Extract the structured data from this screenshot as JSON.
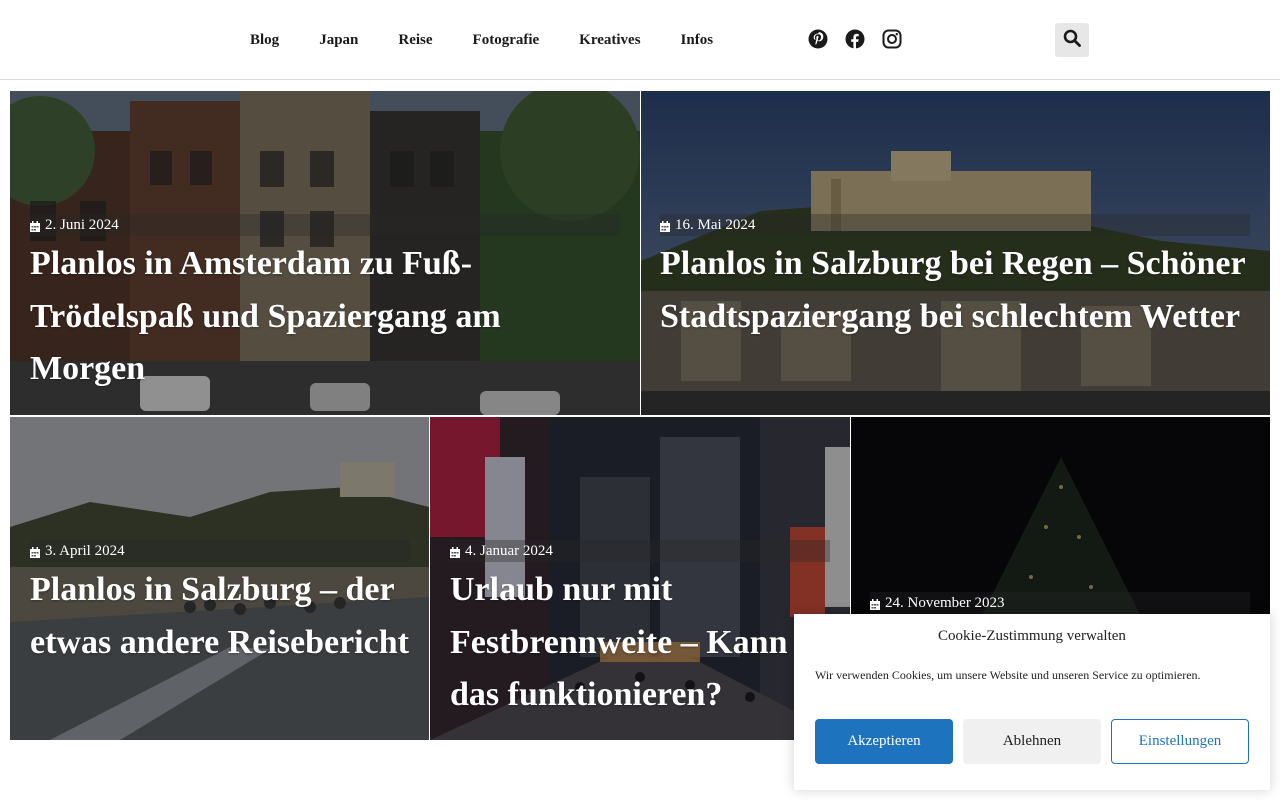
{
  "nav": {
    "items": [
      "Blog",
      "Japan",
      "Reise",
      "Fotografie",
      "Kreatives",
      "Infos"
    ]
  },
  "social": [
    "pinterest-icon",
    "facebook-icon",
    "instagram-icon"
  ],
  "search": {
    "icon": "search-icon"
  },
  "posts": [
    {
      "date": "2. Juni 2024",
      "title": "Planlos in Amsterdam zu Fuß- Trödelspaß und Spaziergang am Morgen"
    },
    {
      "date": "16. Mai 2024",
      "title": "Planlos in Salzburg bei Regen – Schöner Stadtspaziergang bei schlechtem Wetter"
    },
    {
      "date": "3. April 2024",
      "title": "Planlos in Salzburg – der etwas andere Reisebericht"
    },
    {
      "date": "4. Januar 2024",
      "title": "Urlaub nur mit Festbrennweite – Kann das funktionieren?"
    },
    {
      "date": "24. November 2023",
      "title": ""
    }
  ],
  "cookie": {
    "title": "Cookie-Zustimmung verwalten",
    "text": "Wir verwenden Cookies, um unsere Website und unseren Service zu optimieren.",
    "accept": "Akzeptieren",
    "deny": "Ablehnen",
    "settings": "Einstellungen"
  },
  "colors": {
    "accent": "#1e73be",
    "nav_text": "#1a1a1a"
  }
}
